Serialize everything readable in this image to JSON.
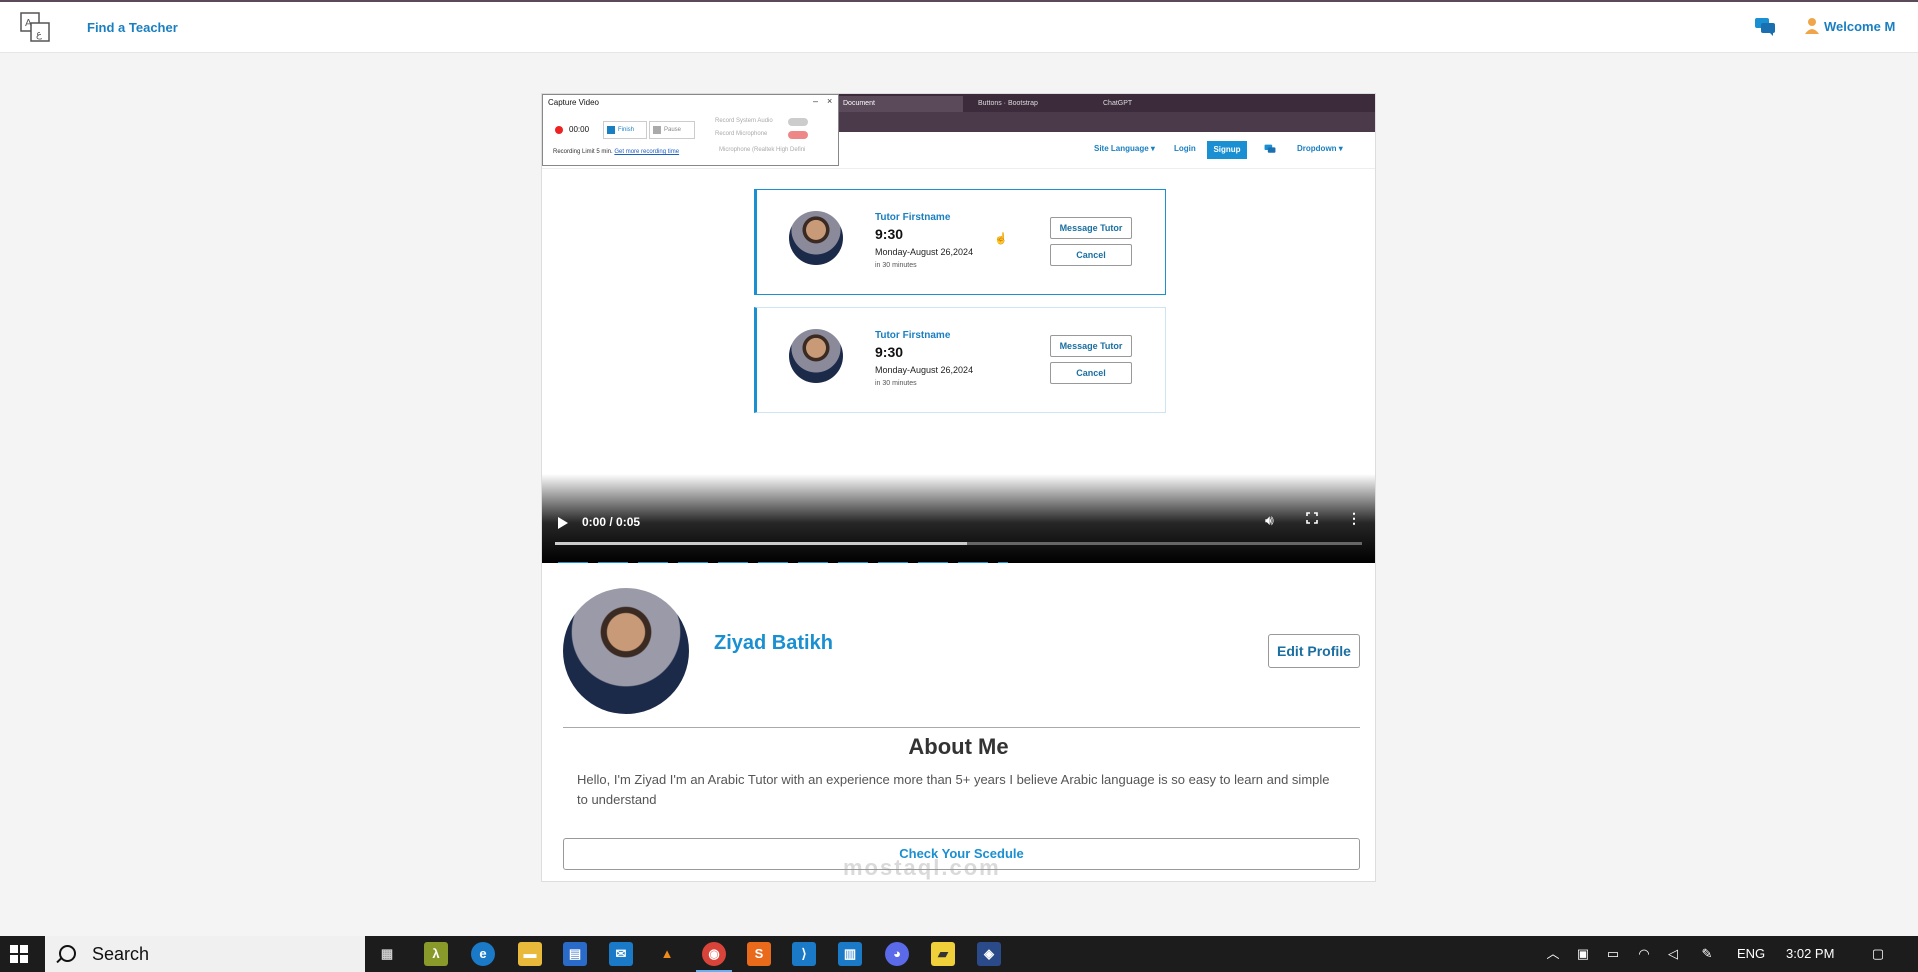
{
  "navbar": {
    "find_teacher": "Find a Teacher",
    "welcome": "Welcome M"
  },
  "video": {
    "recorder": {
      "title": "Capture Video",
      "time": "00:00",
      "finish": "Finish",
      "pause": "Pause",
      "option_system_audio": "Record System Audio",
      "option_microphone": "Record Microphone",
      "option_mic_device": "Microphone (Realtek High Defini",
      "limit_text": "Recording Limit 5 min.",
      "limit_link": "Get more recording time"
    },
    "browser_tabs": [
      "Document",
      "Buttons · Bootstrap",
      "ChatGPT"
    ],
    "inner_nav": {
      "site_language": "Site Language ▾",
      "login": "Login",
      "signup": "Signup",
      "dropdown": "Dropdown ▾"
    },
    "bookings": [
      {
        "tutor": "Tutor Firstname",
        "time": "9:30",
        "date": "Monday-August 26,2024",
        "relative": "in 30 minutes",
        "message": "Message Tutor",
        "cancel": "Cancel"
      },
      {
        "tutor": "Tutor Firstname",
        "time": "9:30",
        "date": "Monday-August 26,2024",
        "relative": "in 30 minutes",
        "message": "Message Tutor",
        "cancel": "Cancel"
      }
    ],
    "player": {
      "time": "0:00 / 0:05",
      "progress_fraction": 0.51
    }
  },
  "profile": {
    "name": "Ziyad Batikh",
    "edit": "Edit Profile",
    "about_title": "About Me",
    "about_text": "Hello, I'm Ziyad I'm an Arabic Tutor with an experience more than 5+ years I believe Arabic language is so easy to learn and simple to understand",
    "schedule": "Check Your Scedule"
  },
  "watermark": "mostaql.com",
  "taskbar": {
    "search": "Search",
    "lang": "ENG",
    "clock": "3:02 PM"
  },
  "colors": {
    "accent": "#1a8fd1",
    "taskbar": "#1c1c1c"
  }
}
